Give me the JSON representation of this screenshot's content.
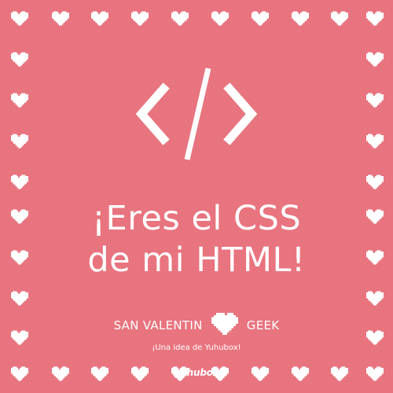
{
  "colors": {
    "background": "#e8747f",
    "foreground": "#ffffff"
  },
  "icons": {
    "code": "code-brackets-icon",
    "heart": "pixel-heart-icon"
  },
  "headline": {
    "line1": "¡Eres el CSS",
    "line2": "de mi HTML!"
  },
  "tagline": {
    "left": "SAN VALENTIN",
    "right": "GEEK"
  },
  "subline": "¡Una idea de Yuhubox!",
  "brand": "yuhubox"
}
